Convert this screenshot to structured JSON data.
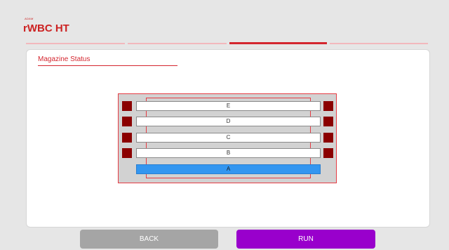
{
  "logo": {
    "small_text": "ADAM",
    "main_text": "WBC HT",
    "mark": "r"
  },
  "steps": [
    {
      "active": false
    },
    {
      "active": false
    },
    {
      "active": true
    },
    {
      "active": false
    }
  ],
  "card": {
    "title": "Magazine Status"
  },
  "magazine": {
    "slots": [
      {
        "label": "E",
        "selected": false
      },
      {
        "label": "D",
        "selected": false
      },
      {
        "label": "C",
        "selected": false
      },
      {
        "label": "B",
        "selected": false
      },
      {
        "label": "A",
        "selected": true
      }
    ]
  },
  "buttons": {
    "back": "BACK",
    "run": "RUN"
  },
  "colors": {
    "accent": "#d4262f",
    "sensor": "#8b0000",
    "selected_slot": "#3396f0",
    "run": "#9900cc",
    "back": "#a5a5a5"
  }
}
